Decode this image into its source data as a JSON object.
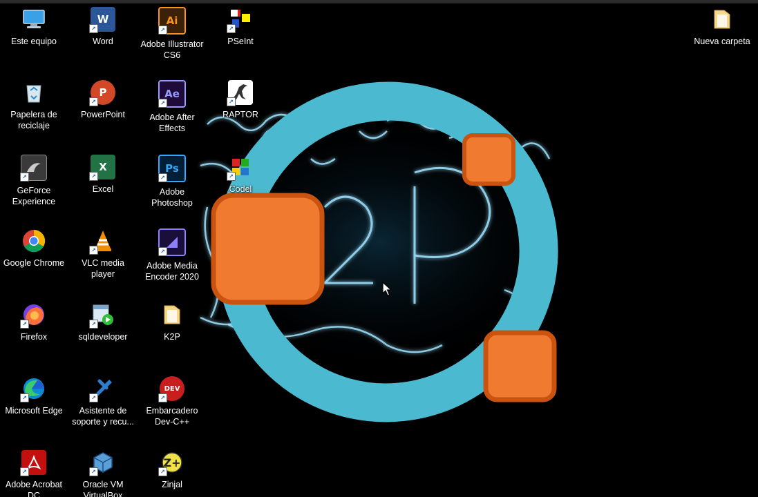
{
  "desktop": {
    "icons": [
      {
        "id": "este-equipo",
        "label": "Este equipo",
        "icon": "computer-icon"
      },
      {
        "id": "word",
        "label": "Word",
        "icon": "word-icon",
        "glyph": "W",
        "color": "#2b579a"
      },
      {
        "id": "illustrator",
        "label": "Adobe Illustrator\nCS6",
        "icon": "illustrator-icon",
        "glyph": "Ai",
        "color": "#f7931e"
      },
      {
        "id": "pseint",
        "label": "PSeInt",
        "icon": "pseint-icon"
      },
      {
        "id": "nueva-carpeta",
        "label": "Nueva carpeta",
        "icon": "folder-icon"
      },
      {
        "id": "papelera",
        "label": "Papelera de\nreciclaje",
        "icon": "recycle-bin-icon"
      },
      {
        "id": "powerpoint",
        "label": "PowerPoint",
        "icon": "powerpoint-icon",
        "glyph": "P",
        "color": "#d24726"
      },
      {
        "id": "after-effects",
        "label": "Adobe After\nEffects",
        "icon": "after-effects-icon",
        "glyph": "Ae",
        "color": "#9999ff"
      },
      {
        "id": "raptor",
        "label": "RAPTOR",
        "icon": "raptor-icon"
      },
      {
        "id": "geforce",
        "label": "GeForce\nExperience",
        "icon": "geforce-icon"
      },
      {
        "id": "excel",
        "label": "Excel",
        "icon": "excel-icon",
        "glyph": "X",
        "color": "#217346"
      },
      {
        "id": "photoshop",
        "label": "Adobe\nPhotoshop",
        "icon": "photoshop-icon",
        "glyph": "Ps",
        "color": "#31a8ff"
      },
      {
        "id": "codeblocks",
        "label": "Codel",
        "icon": "codeblocks-icon"
      },
      {
        "id": "chrome",
        "label": "Google Chrome",
        "icon": "chrome-icon"
      },
      {
        "id": "vlc",
        "label": "VLC media\nplayer",
        "icon": "vlc-icon"
      },
      {
        "id": "media-encoder",
        "label": "Adobe Media\nEncoder 2020",
        "icon": "media-encoder-icon"
      },
      {
        "id": "firefox",
        "label": "Firefox",
        "icon": "firefox-icon"
      },
      {
        "id": "sqldeveloper",
        "label": "sqldeveloper",
        "icon": "sqldeveloper-icon"
      },
      {
        "id": "k2p",
        "label": "K2P",
        "icon": "folder-icon"
      },
      {
        "id": "edge",
        "label": "Microsoft Edge",
        "icon": "edge-icon"
      },
      {
        "id": "asistente",
        "label": "Asistente de\nsoporte y recu...",
        "icon": "support-assistant-icon"
      },
      {
        "id": "devcpp",
        "label": "Embarcadero\nDev-C++",
        "icon": "devcpp-icon",
        "glyph": "DEV",
        "color": "#c81e1e"
      },
      {
        "id": "acrobat",
        "label": "Adobe Acrobat\nDC",
        "icon": "acrobat-icon"
      },
      {
        "id": "virtualbox",
        "label": "Oracle VM\nVirtualBox",
        "icon": "virtualbox-icon"
      },
      {
        "id": "zinjal",
        "label": "Zinjal",
        "icon": "zinjal-icon"
      }
    ],
    "wallpaper": {
      "logo_text": "K2P",
      "colors": {
        "ring": "#4bbad1",
        "square": "#f07a30",
        "square_border": "#c9530f",
        "glow": "#9fe3ff"
      }
    }
  }
}
